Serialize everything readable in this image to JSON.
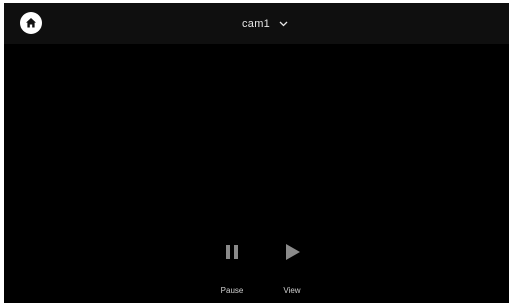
{
  "header": {
    "home_icon": "home-icon",
    "camera": {
      "selected": "cam1",
      "dropdown_icon": "chevron-down-icon"
    }
  },
  "controls": {
    "pause": {
      "label": "Pause",
      "icon": "pause-icon"
    },
    "view": {
      "label": "View",
      "icon": "play-icon"
    }
  },
  "colors": {
    "background": "#000000",
    "topbar": "#0f0f0f",
    "icon_muted": "#8a8a8a",
    "text": "#e6e6e6"
  }
}
